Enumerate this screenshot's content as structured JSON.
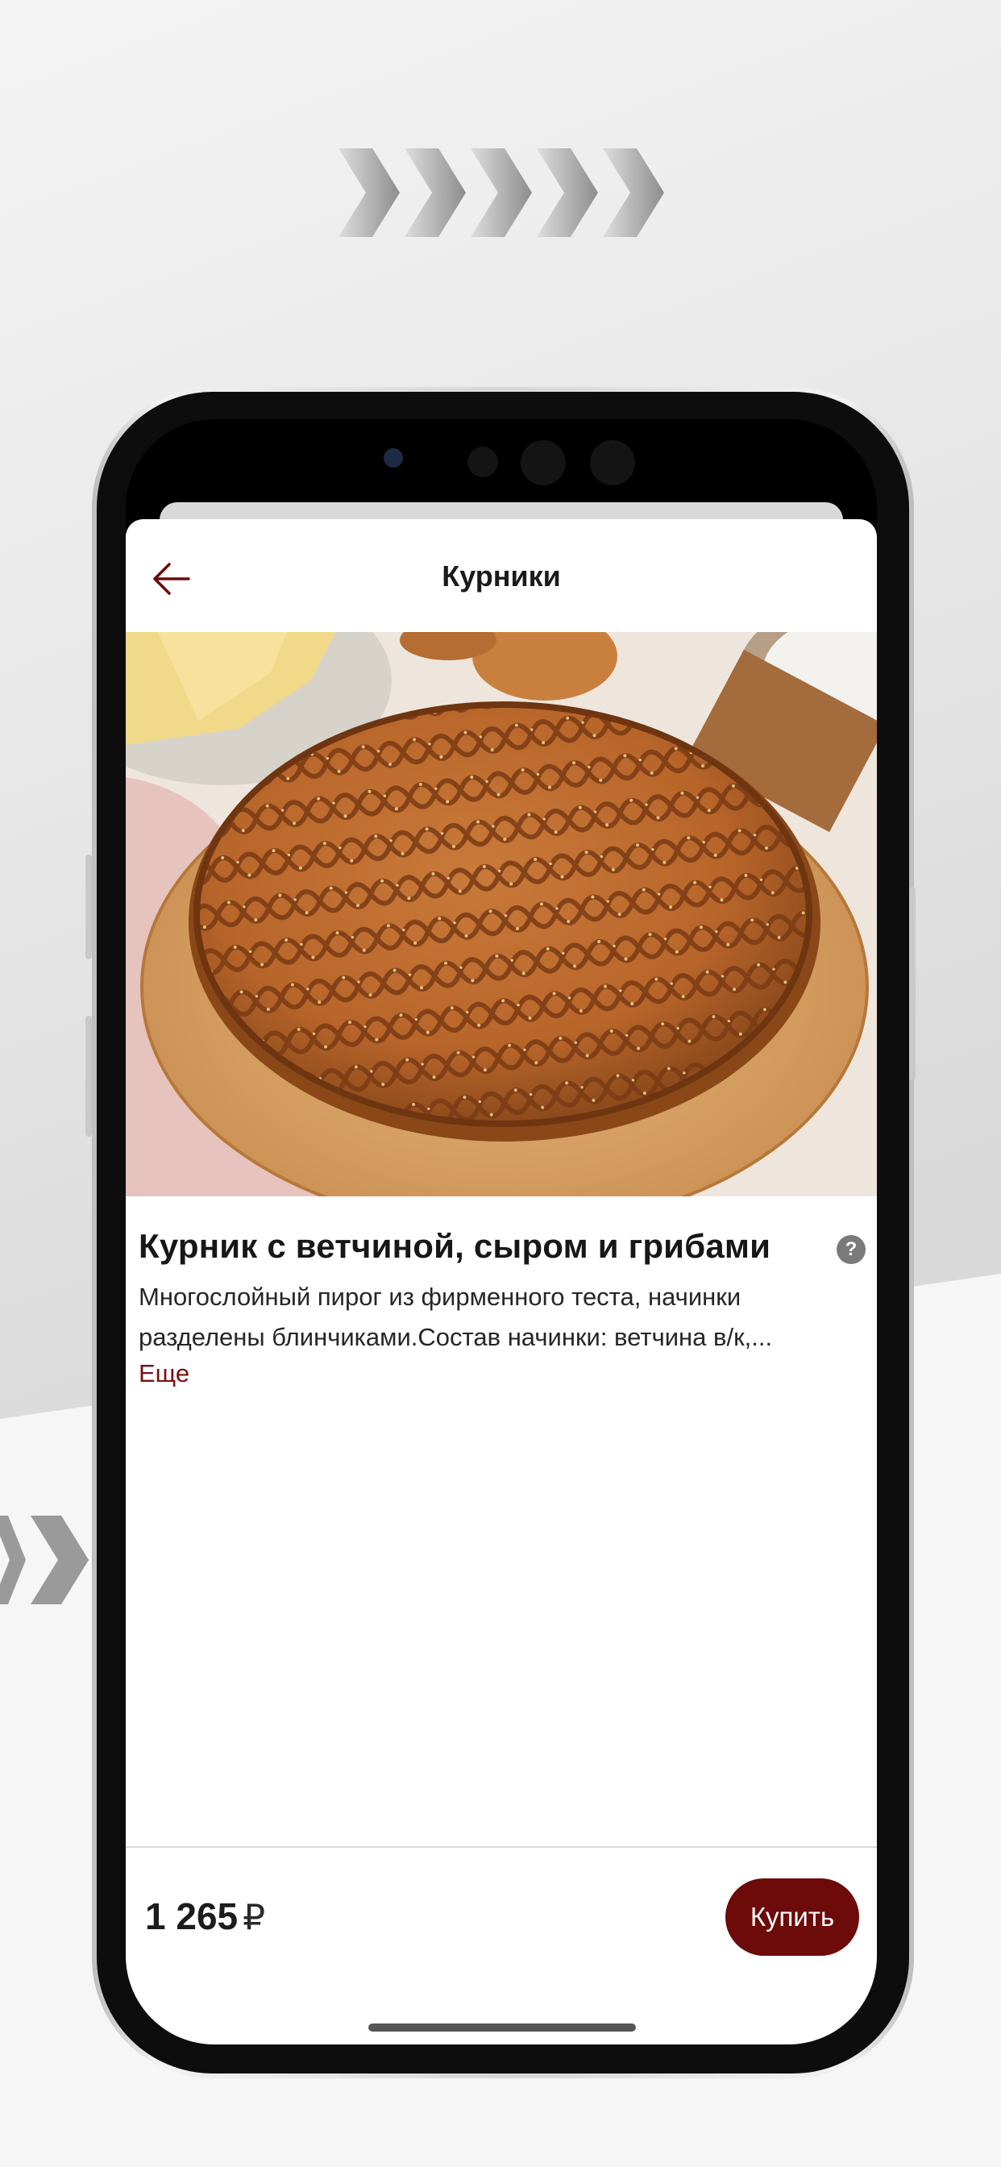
{
  "header": {
    "title": "Курники",
    "back_icon": "arrow-left-icon"
  },
  "product": {
    "title": "Курник с ветчиной, сыром и грибами",
    "description": "Многослойный пирог из фирменного теста, начинки разделены блинчиками.Состав начинки: ветчина в/к,...",
    "more_label": "Еще",
    "help_icon": "question-circle-icon",
    "help_glyph": "?"
  },
  "footer": {
    "price": "1 265",
    "currency": "₽",
    "buy_label": "Купить"
  },
  "colors": {
    "accent": "#6d0a0a",
    "link": "#7a1010",
    "title": "#171717"
  }
}
